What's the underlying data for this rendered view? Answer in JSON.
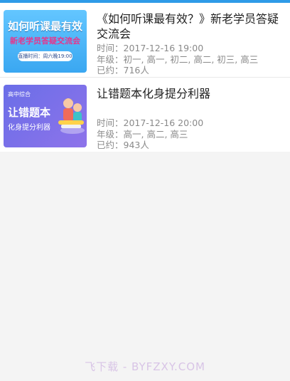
{
  "colors": {
    "accent": "#2f9be8",
    "title_text": "#222222",
    "meta_text": "#8a8a8a",
    "background": "#f4f4f4"
  },
  "lectures": [
    {
      "thumbnail": {
        "title": "如何听课最有效",
        "subtitle": "新老学员答疑交流会",
        "time_label": "直播时间：周六晚19:00"
      },
      "title": "《如何听课最有效？》新老学员答疑交流会",
      "time": "时间：2017-12-16 19:00",
      "grade": "年级：初一, 高一, 初二, 高二, 初三, 高三",
      "booked": "已约：716人"
    },
    {
      "thumbnail": {
        "tag": "高中综合",
        "title": "让错题本",
        "subtitle": "化身提分利器"
      },
      "title": "让错题本化身提分利器",
      "time": "时间：2017-12-16 20:00",
      "grade": "年级：高一, 高二, 高三",
      "booked": "已约：943人"
    }
  ],
  "watermark": "飞下载 - BYFZXY.COM"
}
